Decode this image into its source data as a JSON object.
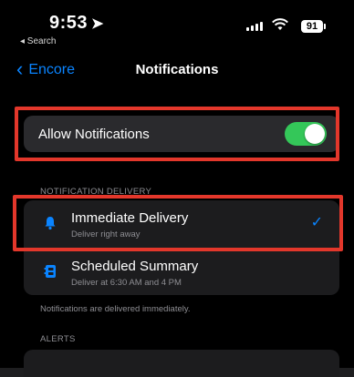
{
  "status_bar": {
    "time": "9:53",
    "back_app": "◂ Search",
    "battery": "91"
  },
  "nav": {
    "back_label": "Encore",
    "title": "Notifications"
  },
  "allow": {
    "label": "Allow Notifications",
    "enabled": true
  },
  "delivery": {
    "header": "NOTIFICATION DELIVERY",
    "options": [
      {
        "title": "Immediate Delivery",
        "subtitle": "Deliver right away",
        "selected": true,
        "icon": "bell-icon"
      },
      {
        "title": "Scheduled Summary",
        "subtitle": "Deliver at 6:30 AM and 4 PM",
        "selected": false,
        "icon": "summary-icon"
      }
    ],
    "footer": "Notifications are delivered immediately."
  },
  "alerts": {
    "header": "ALERTS"
  },
  "colors": {
    "accent": "#0a84ff",
    "toggle_on": "#34c759",
    "highlight": "#e3372b"
  }
}
